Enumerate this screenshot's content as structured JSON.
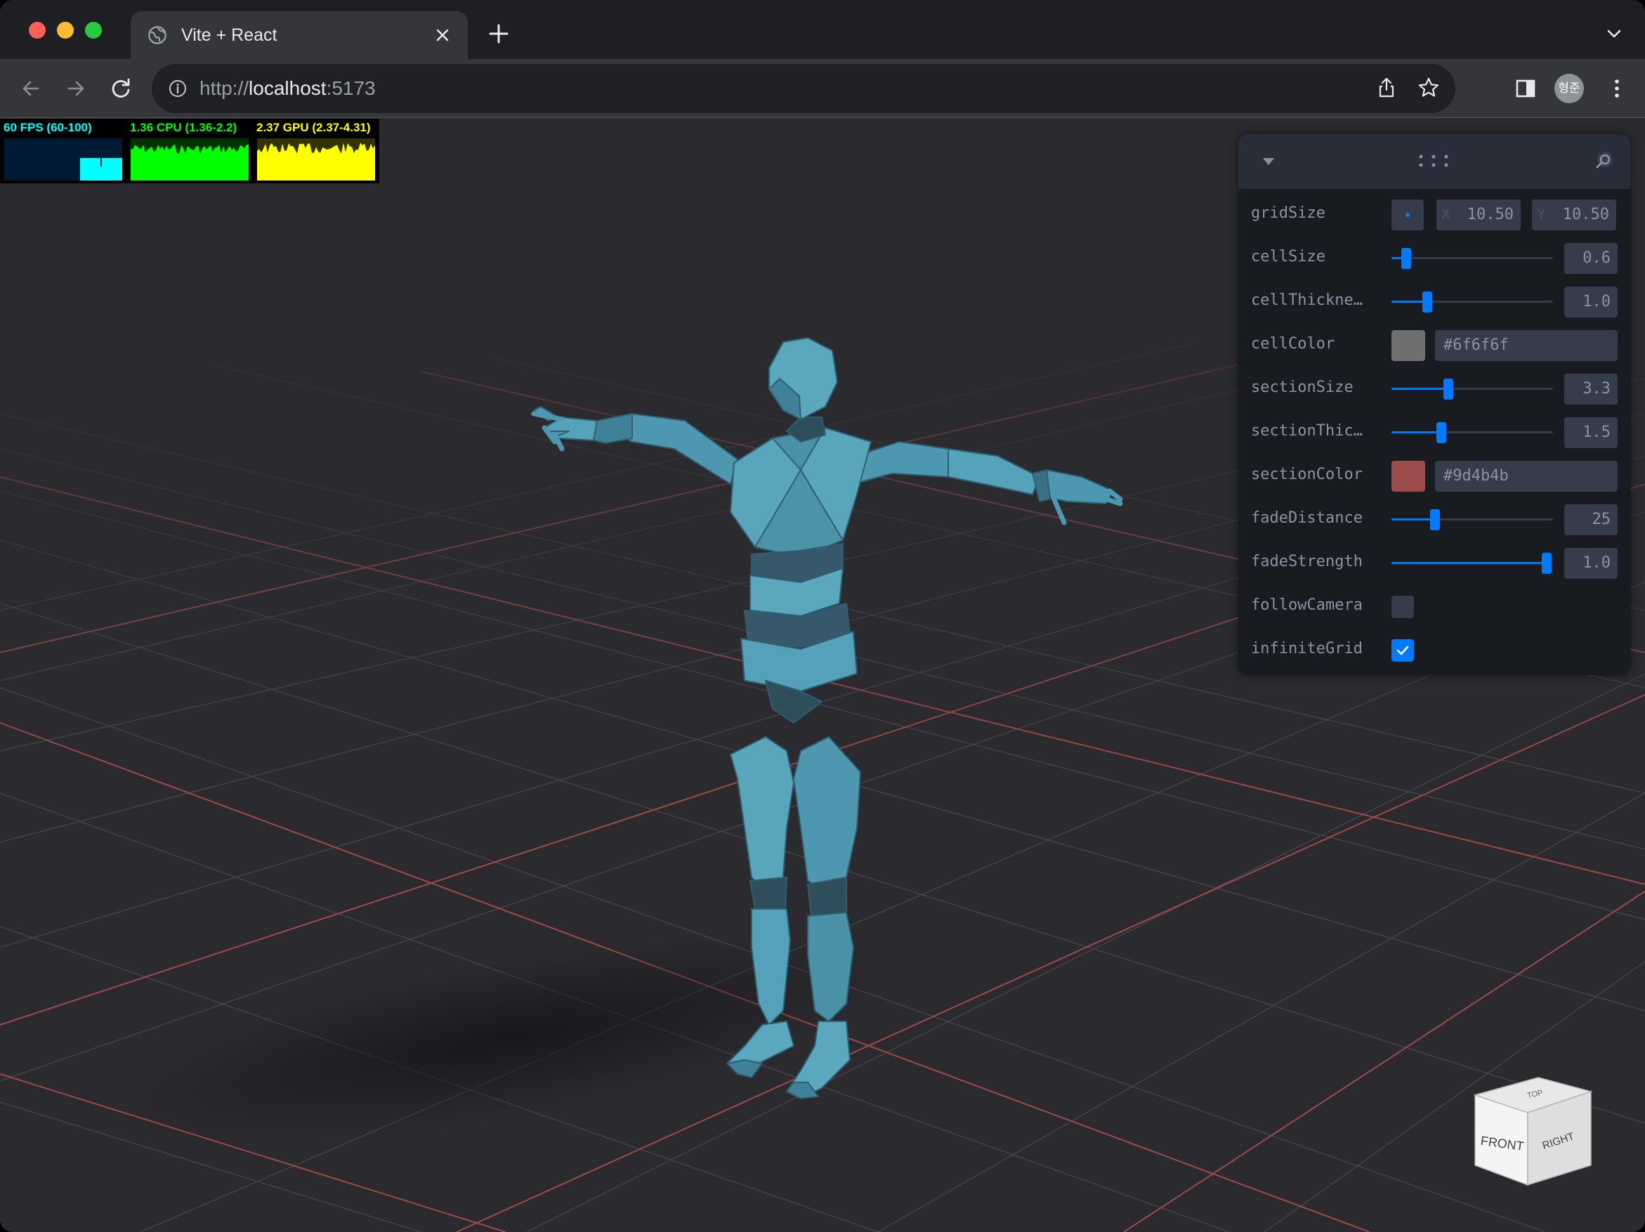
{
  "browser": {
    "tab_title": "Vite + React",
    "url_scheme": "http://",
    "url_host": "localhost",
    "url_port": ":5173",
    "profile_initials": "형준"
  },
  "stats": [
    {
      "label": "60 FPS (60-100)",
      "color": "#00ffff",
      "bg": "#001a33"
    },
    {
      "label": "1.36 CPU (1.36-2.2)",
      "color": "#00ff00",
      "bg": "#003300"
    },
    {
      "label": "2.37 GPU (2.37-4.31)",
      "color": "#ffff00",
      "bg": "#333300"
    }
  ],
  "panel": {
    "gridSize": {
      "label": "gridSize",
      "x_axis": "X",
      "x": "10.50",
      "y_axis": "Y",
      "y": "10.50"
    },
    "cellSize": {
      "label": "cellSize",
      "value": "0.6",
      "fraction": 0.09
    },
    "cellThickness": {
      "label": "cellThickness",
      "value": "1.0",
      "fraction": 0.22
    },
    "cellColor": {
      "label": "cellColor",
      "value": "#6f6f6f"
    },
    "sectionSize": {
      "label": "sectionSize",
      "value": "3.3",
      "fraction": 0.35
    },
    "sectionThickness": {
      "label": "sectionThickness",
      "value": "1.5",
      "fraction": 0.31
    },
    "sectionColor": {
      "label": "sectionColor",
      "value": "#9d4b4b"
    },
    "fadeDistance": {
      "label": "fadeDistance",
      "value": "25",
      "fraction": 0.27
    },
    "fadeStrength": {
      "label": "fadeStrength",
      "value": "1.0",
      "fraction": 0.96
    },
    "followCamera": {
      "label": "followCamera",
      "checked": false
    },
    "infiniteGrid": {
      "label": "infiniteGrid",
      "checked": true
    }
  },
  "viewcube": {
    "front": "FRONT",
    "right": "RIGHT",
    "top": "TOP"
  },
  "colors": {
    "accent": "#007bff",
    "mannequin": "#4f9ab2",
    "scene_bg": "#2b2a2f"
  }
}
